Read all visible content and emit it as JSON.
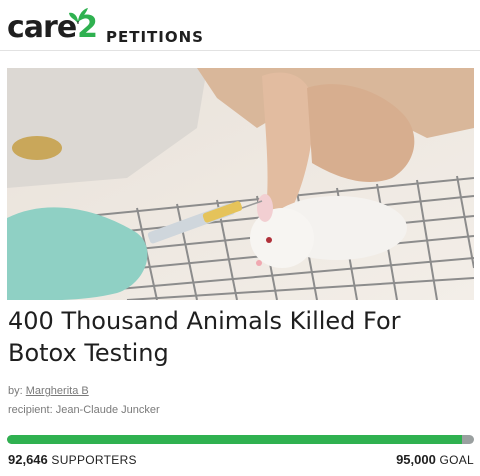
{
  "header": {
    "logo_word": "care",
    "logo_number": "2",
    "section": "PETITIONS"
  },
  "petition": {
    "title": "400 Thousand Animals Killed For Botox Testing",
    "by_label": "by:",
    "author": "Margherita B",
    "recipient_label": "recipient:",
    "recipient": "Jean-Claude Juncker"
  },
  "progress": {
    "supporters_count": "92,646",
    "supporters_label": "SUPPORTERS",
    "goal_count": "95,000",
    "goal_label": "GOAL",
    "fraction": 0.975
  },
  "colors": {
    "brand_green": "#2fb150",
    "track_gray": "#9aa0a0",
    "text_dark": "#1f1f1f",
    "text_muted": "#7a7a7a"
  },
  "icons": {
    "logo_mark": "butterfly-icon"
  }
}
